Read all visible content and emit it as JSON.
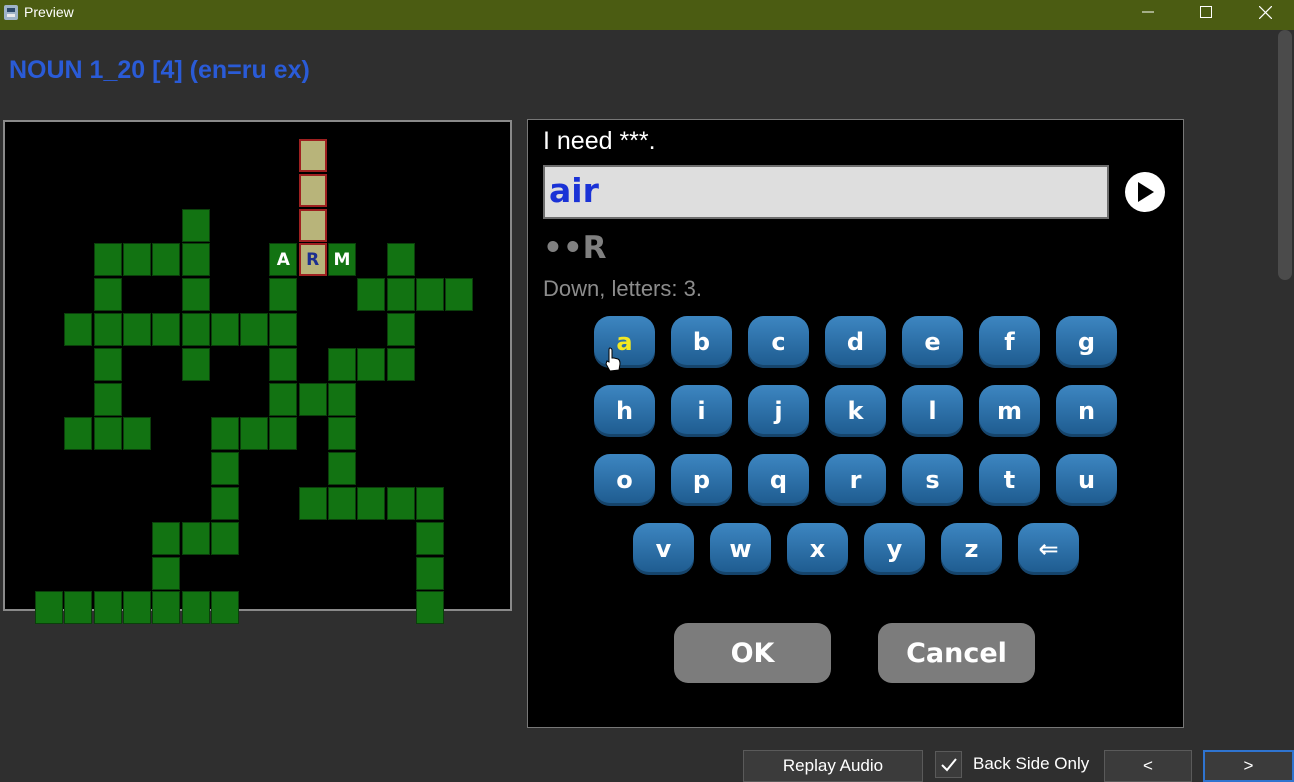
{
  "window": {
    "title": "Preview"
  },
  "deck": {
    "title": "NOUN 1_20 [4] (en=ru ex)"
  },
  "grid": {
    "placed_letters": [
      "A",
      "R",
      "M"
    ]
  },
  "clue": {
    "prompt": "I need ***.",
    "answer_value": "air",
    "pattern": "••R",
    "info": "Down, letters: 3."
  },
  "keyboard": {
    "rows": [
      [
        "a",
        "b",
        "c",
        "d",
        "e",
        "f",
        "g"
      ],
      [
        "h",
        "i",
        "j",
        "k",
        "l",
        "m",
        "n"
      ],
      [
        "o",
        "p",
        "q",
        "r",
        "s",
        "t",
        "u"
      ],
      [
        "v",
        "w",
        "x",
        "y",
        "z",
        "⇐"
      ]
    ],
    "highlighted_key": "a"
  },
  "actions": {
    "ok": "OK",
    "cancel": "Cancel"
  },
  "bottom": {
    "replay": "Replay Audio",
    "back_side_only": "Back Side Only",
    "back_side_only_checked": true,
    "prev": "<",
    "next": ">"
  },
  "colors": {
    "titlebar": "#4b5c12",
    "deck_title": "#2a5bd7",
    "cell": "#127312",
    "active_cell": "#b8b47a",
    "key": "#2b6ea6",
    "answer_text": "#1a32d6"
  }
}
